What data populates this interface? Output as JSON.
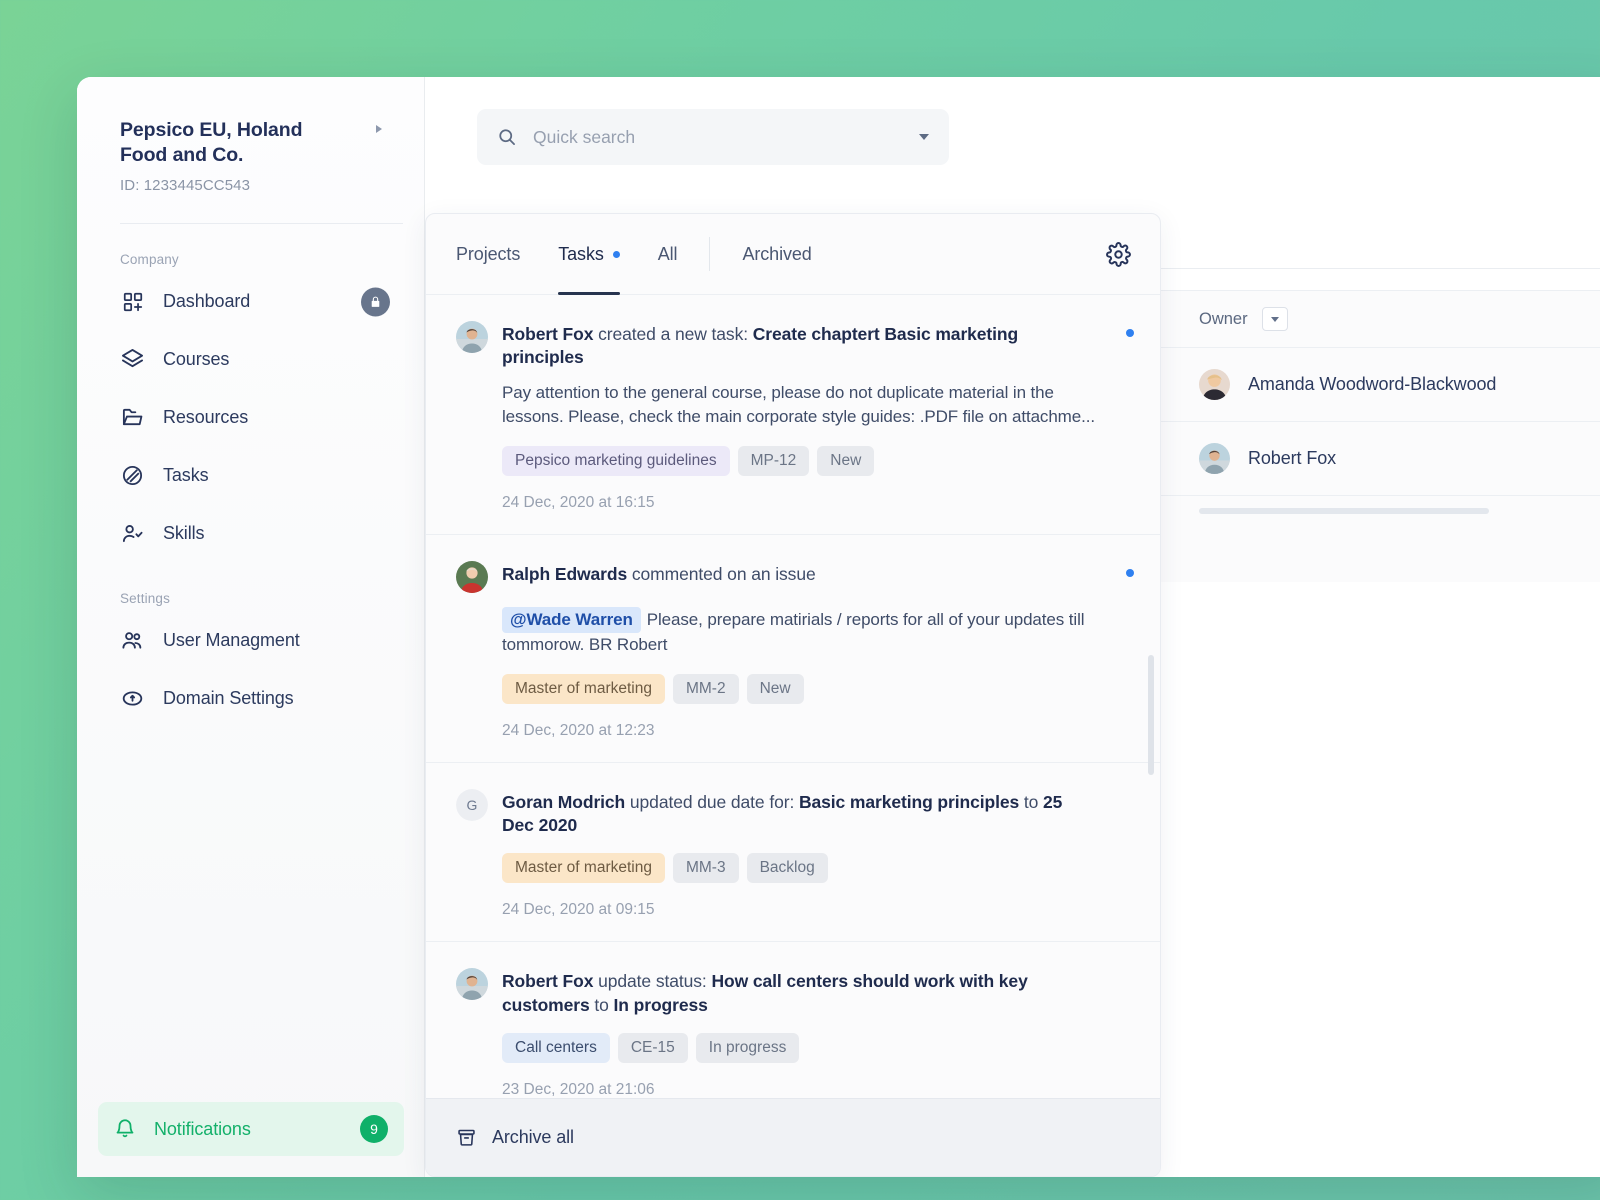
{
  "background": {
    "from": "#7ad396",
    "to": "#6cc5ac"
  },
  "sidebar": {
    "org_name": "Pepsico EU, Holand Food and Co.",
    "org_id": "ID: 1233445CC543",
    "section_company": "Company",
    "section_settings": "Settings",
    "company_items": [
      {
        "label": "Dashboard",
        "icon": "dashboard-grid-icon",
        "locked": true
      },
      {
        "label": "Courses",
        "icon": "layers-icon",
        "locked": false
      },
      {
        "label": "Resources",
        "icon": "folder-icon",
        "locked": false
      },
      {
        "label": "Tasks",
        "icon": "pie-circle-icon",
        "locked": false
      },
      {
        "label": "Skills",
        "icon": "user-check-icon",
        "locked": false
      }
    ],
    "settings_items": [
      {
        "label": "User Managment",
        "icon": "users-icon"
      },
      {
        "label": "Domain Settings",
        "icon": "domain-info-icon"
      }
    ],
    "notifications": {
      "label": "Notifications",
      "count": "9",
      "icon": "bell-icon",
      "accent": "#0fb069",
      "background": "#e3f6ec"
    }
  },
  "search": {
    "placeholder": "Quick search",
    "value": "",
    "icon": "search-icon"
  },
  "feed": {
    "tabs": [
      {
        "label": "Projects",
        "active": false,
        "dot": false
      },
      {
        "label": "Tasks",
        "active": true,
        "dot": true
      },
      {
        "label": "All",
        "active": false,
        "dot": false
      },
      {
        "label": "Archived",
        "active": false,
        "dot": false
      }
    ],
    "settings_icon": "gear-icon",
    "archive_all": {
      "label": "Archive all",
      "icon": "archive-box-icon"
    },
    "items": [
      {
        "actor": "Robert Fox",
        "action_pre": " created a new task: ",
        "action_bold": "Create chaptert Basic marketing principles",
        "action_post": "",
        "body": "Pay attention to the general course, please do not duplicate material in the lessons. Please, check the main corporate style guides: .PDF file on attachme...",
        "mention": "",
        "chips": [
          {
            "text": "Pepsico marketing guidelines",
            "style": "purple"
          },
          {
            "text": "MP-12",
            "style": "grey"
          },
          {
            "text": "New",
            "style": "grey"
          }
        ],
        "time": "24 Dec, 2020 at 16:15",
        "unread": true,
        "avatar_type": "photo-male"
      },
      {
        "actor": "Ralph Edwards",
        "action_pre": " commented on an issue",
        "action_bold": "",
        "action_post": "",
        "body": "Please, prepare matirials / reports for all of your updates till tommorow. BR Robert",
        "mention": "@Wade Warren",
        "chips": [
          {
            "text": "Master of marketing",
            "style": "orange"
          },
          {
            "text": "MM-2",
            "style": "grey"
          },
          {
            "text": "New",
            "style": "grey"
          }
        ],
        "time": "24 Dec, 2020 at 12:23",
        "unread": true,
        "avatar_type": "photo-red"
      },
      {
        "actor": "Goran Modrich",
        "action_pre": " updated due date for: ",
        "action_bold": "Basic marketing principles",
        "action_post": " to ",
        "action_bold2": "25 Dec 2020",
        "body": "",
        "mention": "",
        "chips": [
          {
            "text": "Master of marketing",
            "style": "orange"
          },
          {
            "text": "MM-3",
            "style": "grey"
          },
          {
            "text": "Backlog",
            "style": "grey"
          }
        ],
        "time": "24 Dec, 2020 at 09:15",
        "unread": false,
        "avatar_type": "letter",
        "avatar_letter": "G"
      },
      {
        "actor": "Robert Fox",
        "action_pre": " update status: ",
        "action_bold": "How call centers should work with key customers",
        "action_post": " to ",
        "action_bold2": "In progress",
        "body": "",
        "mention": "",
        "chips": [
          {
            "text": "Call centers",
            "style": "blue"
          },
          {
            "text": "CE-15",
            "style": "grey"
          },
          {
            "text": "In progress",
            "style": "grey"
          }
        ],
        "time": "23 Dec, 2020 at 21:06",
        "unread": false,
        "avatar_type": "photo-male"
      }
    ]
  },
  "owner_panel": {
    "column_label": "Owner",
    "rows": [
      {
        "name": "Amanda Woodword-Blackwood",
        "avatar_type": "photo-female"
      },
      {
        "name": "Robert Fox",
        "avatar_type": "photo-male"
      }
    ]
  }
}
